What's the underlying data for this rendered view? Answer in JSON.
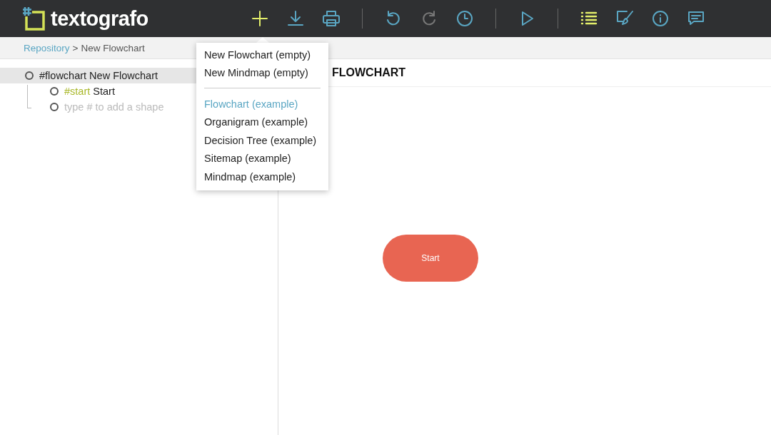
{
  "app": {
    "logo": "textografo"
  },
  "toolbar": [
    [
      {
        "kind": "add",
        "selected": true,
        "disabled": false
      },
      {
        "kind": "download",
        "selected": false,
        "disabled": false
      },
      {
        "kind": "print",
        "selected": false,
        "disabled": false
      }
    ],
    [
      {
        "kind": "undo",
        "selected": false,
        "disabled": false
      },
      {
        "kind": "redo",
        "selected": false,
        "disabled": true
      },
      {
        "kind": "history",
        "selected": false,
        "disabled": false
      }
    ],
    [
      {
        "kind": "play",
        "selected": false,
        "disabled": false
      }
    ],
    [
      {
        "kind": "outline",
        "selected": true,
        "disabled": false
      },
      {
        "kind": "design",
        "selected": false,
        "disabled": false
      },
      {
        "kind": "info",
        "selected": false,
        "disabled": false
      },
      {
        "kind": "comments",
        "selected": false,
        "disabled": false
      }
    ]
  ],
  "breadcrumb": {
    "link": "Repository",
    "separator": ">",
    "current": "New Flowchart"
  },
  "outline": [
    {
      "tag": "#flowchart",
      "label": "New Flowchart",
      "selected": true,
      "children": [
        {
          "kind": "shape",
          "tag": "#start",
          "label": "Start",
          "selected": false
        },
        {
          "kind": "hint",
          "placeholder": "type # to add a shape",
          "selected": false
        }
      ]
    }
  ],
  "canvas": {
    "title": "FLOWCHART",
    "shapes": [
      {
        "kind": "terminator",
        "label": "Start"
      }
    ]
  },
  "add_menu": {
    "groups": [
      [
        {
          "label": "New Flowchart (empty)",
          "selected": false
        },
        {
          "label": "New Mindmap (empty)",
          "selected": false
        }
      ],
      [
        {
          "label": "Flowchart (example)",
          "selected": true
        },
        {
          "label": "Organigram (example)",
          "selected": false
        },
        {
          "label": "Decision Tree (example)",
          "selected": false
        },
        {
          "label": "Sitemap (example)",
          "selected": false
        },
        {
          "label": "Mindmap (example)",
          "selected": false
        }
      ]
    ]
  }
}
